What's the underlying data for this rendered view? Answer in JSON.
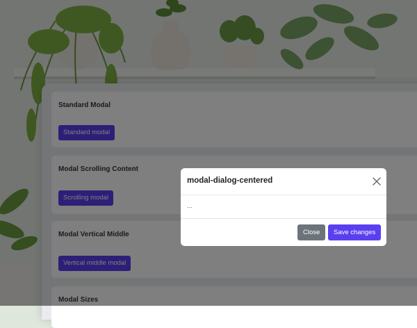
{
  "cards": [
    {
      "title": "Standard Modal",
      "button_label": "Standard modal"
    },
    {
      "title": "Modal Scrolling Content",
      "button_label": "Scrolling modal"
    },
    {
      "title": "Modal Vertical Middle",
      "button_label": "Vertical middle modal"
    },
    {
      "title": "Modal Sizes",
      "button_label": ""
    }
  ],
  "modal": {
    "title": "modal-dialog-centered",
    "body": "...",
    "close_label": "Close",
    "save_label": "Save changes"
  },
  "colors": {
    "primary": "#5a3ff0",
    "secondary": "#6c737a",
    "backdrop": "rgba(0,0,0,0.5)"
  },
  "icons": {
    "close": "close-icon"
  }
}
